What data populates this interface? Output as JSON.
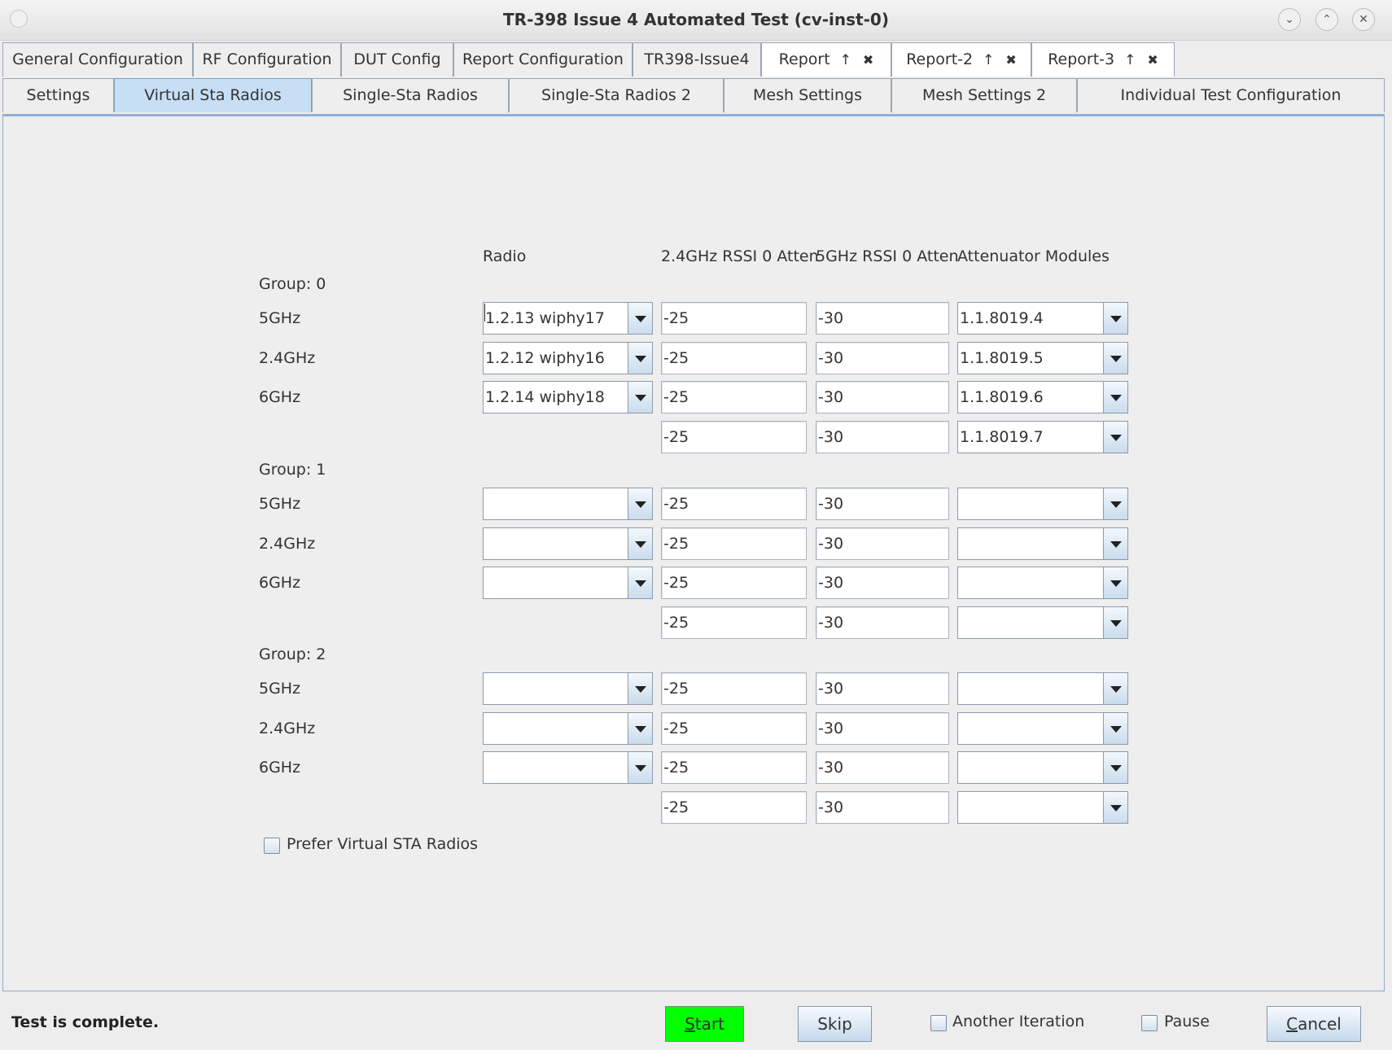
{
  "window": {
    "title": "TR-398 Issue 4 Automated Test  (cv-inst-0)",
    "controls": [
      "minimize",
      "maximize",
      "close"
    ]
  },
  "tabs_row1": [
    {
      "label": "General Configuration"
    },
    {
      "label": "RF Configuration"
    },
    {
      "label": "DUT Config"
    },
    {
      "label": "Report Configuration"
    },
    {
      "label": "TR398-Issue4"
    },
    {
      "label": "Report",
      "icon": "↑",
      "close": "✖"
    },
    {
      "label": "Report-2",
      "icon": "↑",
      "close": "✖"
    },
    {
      "label": "Report-3",
      "icon": "↑",
      "close": "✖"
    }
  ],
  "tabs_row2": [
    {
      "label": "Settings"
    },
    {
      "label": "Virtual Sta Radios",
      "active": true
    },
    {
      "label": "Single-Sta Radios"
    },
    {
      "label": "Single-Sta Radios 2"
    },
    {
      "label": "Mesh Settings"
    },
    {
      "label": "Mesh Settings 2"
    },
    {
      "label": "Individual Test Configuration"
    }
  ],
  "columns": {
    "radio": "Radio",
    "rssi24": "2.4GHz RSSI 0 Atten",
    "rssi5": "5GHz RSSI 0 Atten",
    "atten": "Attenuator Modules"
  },
  "groups": [
    {
      "label": "Group: 0",
      "rows": [
        {
          "band": "5GHz",
          "radio": "1.2.13 wiphy17",
          "rssi24": "-25",
          "rssi5": "-30",
          "atten": "1.1.8019.4"
        },
        {
          "band": "2.4GHz",
          "radio": "1.2.12 wiphy16",
          "rssi24": "-25",
          "rssi5": "-30",
          "atten": "1.1.8019.5"
        },
        {
          "band": "6GHz",
          "radio": "1.2.14 wiphy18",
          "rssi24": "-25",
          "rssi5": "-30",
          "atten": "1.1.8019.6"
        },
        {
          "band": "",
          "radio": null,
          "rssi24": "-25",
          "rssi5": "-30",
          "atten": "1.1.8019.7"
        }
      ]
    },
    {
      "label": "Group: 1",
      "rows": [
        {
          "band": "5GHz",
          "radio": "",
          "rssi24": "-25",
          "rssi5": "-30",
          "atten": ""
        },
        {
          "band": "2.4GHz",
          "radio": "",
          "rssi24": "-25",
          "rssi5": "-30",
          "atten": ""
        },
        {
          "band": "6GHz",
          "radio": "",
          "rssi24": "-25",
          "rssi5": "-30",
          "atten": ""
        },
        {
          "band": "",
          "radio": null,
          "rssi24": "-25",
          "rssi5": "-30",
          "atten": ""
        }
      ]
    },
    {
      "label": "Group: 2",
      "rows": [
        {
          "band": "5GHz",
          "radio": "",
          "rssi24": "-25",
          "rssi5": "-30",
          "atten": ""
        },
        {
          "band": "2.4GHz",
          "radio": "",
          "rssi24": "-25",
          "rssi5": "-30",
          "atten": ""
        },
        {
          "band": "6GHz",
          "radio": "",
          "rssi24": "-25",
          "rssi5": "-30",
          "atten": ""
        },
        {
          "band": "",
          "radio": null,
          "rssi24": "-25",
          "rssi5": "-30",
          "atten": ""
        }
      ]
    }
  ],
  "prefer_virtual": {
    "label": "Prefer Virtual STA Radios",
    "checked": false
  },
  "bottom": {
    "status": "Test is complete.",
    "start_first": "S",
    "start_rest": "tart",
    "skip": "Skip",
    "another_iteration": "Another Iteration",
    "pause": "Pause",
    "cancel_first": "C",
    "cancel_rest": "ancel",
    "start_color": "#00ff00"
  }
}
